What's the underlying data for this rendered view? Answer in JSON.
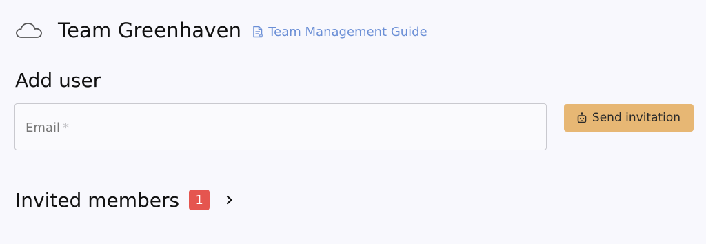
{
  "header": {
    "team_name": "Team Greenhaven",
    "guide_link_label": "Team Management Guide",
    "cloud_icon": "cloud-icon",
    "guide_icon": "document-icon"
  },
  "add_user": {
    "title": "Add user",
    "email_label": "Email",
    "required_marker": "*",
    "email_value": "",
    "send_button_label": "Send invitation",
    "send_button_icon": "robot-icon"
  },
  "invited": {
    "title": "Invited members",
    "count": "1",
    "chevron_icon": "chevron-right-icon"
  },
  "colors": {
    "background": "#f8f8fd",
    "link": "#6b8fd6",
    "button": "#e7b774",
    "badge": "#e5554f"
  }
}
